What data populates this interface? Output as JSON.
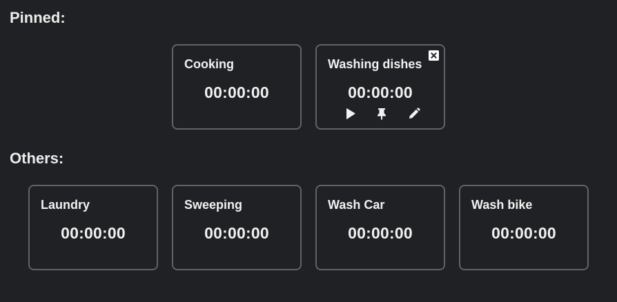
{
  "sections": {
    "pinned_title": "Pinned:",
    "others_title": "Others:"
  },
  "pinned": [
    {
      "title": "Cooking",
      "time": "00:00:00"
    },
    {
      "title": "Washing dishes",
      "time": "00:00:00"
    }
  ],
  "others": [
    {
      "title": "Laundry",
      "time": "00:00:00"
    },
    {
      "title": "Sweeping",
      "time": "00:00:00"
    },
    {
      "title": "Wash Car",
      "time": "00:00:00"
    },
    {
      "title": "Wash bike",
      "time": "00:00:00"
    }
  ],
  "icons": {
    "close": "close-icon",
    "play": "play-icon",
    "pin": "pin-icon",
    "edit": "pencil-icon"
  },
  "colors": {
    "background": "#202124",
    "card_border": "#5f6368",
    "text": "#f1f1f1"
  }
}
